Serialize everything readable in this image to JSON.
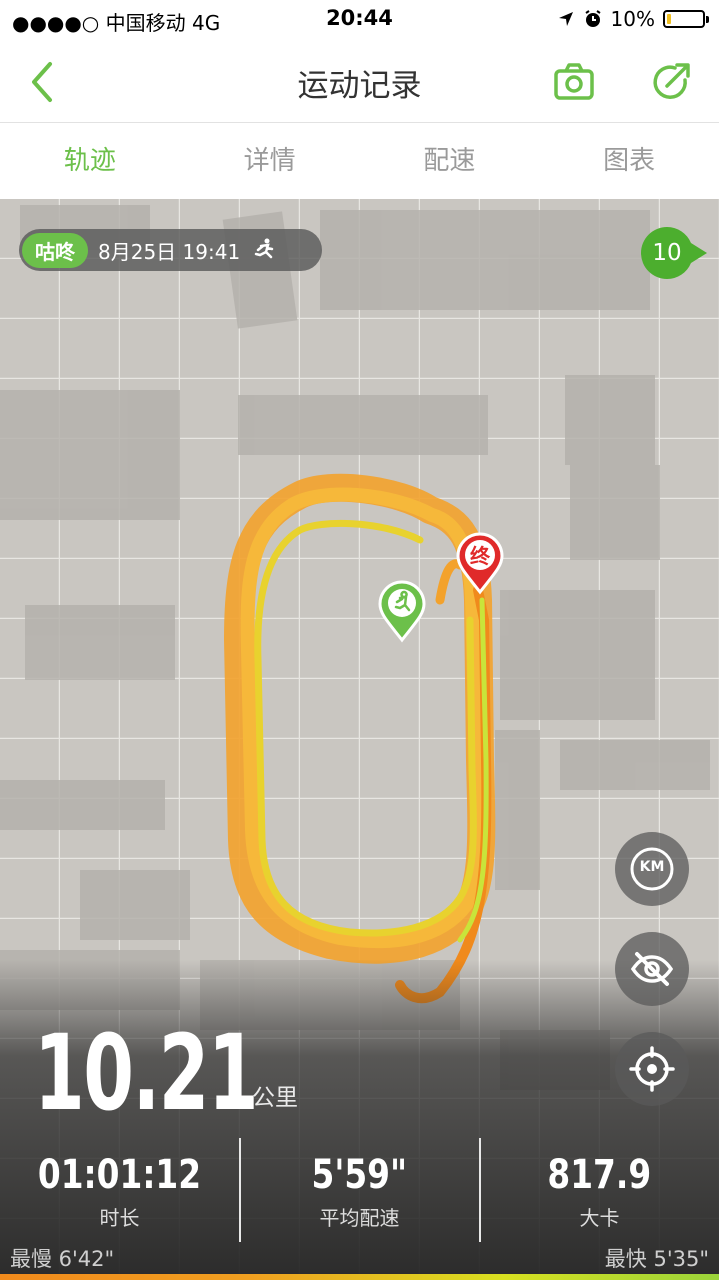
{
  "status_bar": {
    "carrier": "●●●●○ 中国移动  4G",
    "time": "20:44",
    "battery": "10%",
    "battery_level": 0.1
  },
  "nav": {
    "title": "运动记录"
  },
  "tabs": [
    {
      "label": "轨迹",
      "active": true
    },
    {
      "label": "详情",
      "active": false
    },
    {
      "label": "配速",
      "active": false
    },
    {
      "label": "图表",
      "active": false
    }
  ],
  "map": {
    "user_name": "咕咚",
    "record_time": "8月25日 19:41",
    "km_marker": "10",
    "end_marker": "终",
    "buttons": {
      "km": "KM"
    }
  },
  "summary": {
    "distance": "10.21",
    "distance_unit": "公里",
    "duration": "01:01:12",
    "duration_label": "时长",
    "avg_pace": "5'59\"",
    "avg_pace_label": "平均配速",
    "calories": "817.9",
    "calories_label": "大卡",
    "slowest": "最慢 6'42\"",
    "fastest": "最快 5'35\""
  },
  "colors": {
    "accent": "#6cc04a",
    "end_marker": "#e02a2a",
    "track_orange": "#f2a02a",
    "track_yellow": "#d8e23a"
  }
}
